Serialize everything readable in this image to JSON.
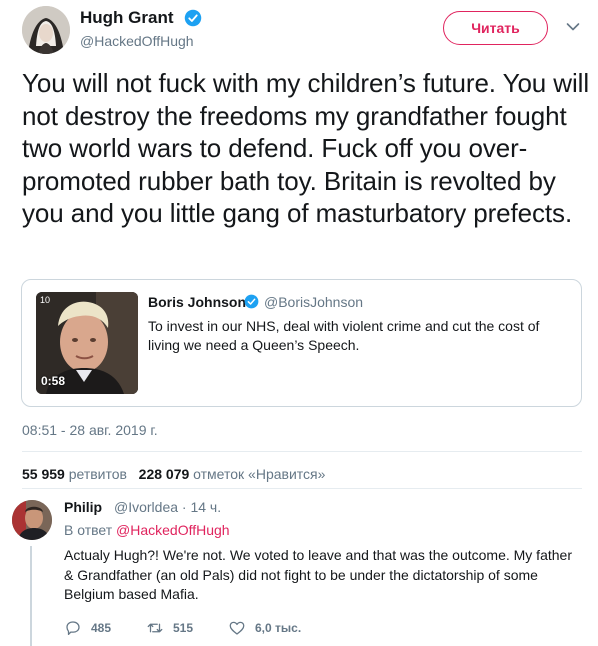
{
  "tweet": {
    "author_name": "Hugh Grant",
    "author_handle": "@HackedOffHugh",
    "follow_label": "Читать",
    "text": "You will not fuck with my children’s future. You will not destroy the freedoms my grandfather fought two world wars to defend. Fuck off you over-promoted rubber bath toy. Britain is revolted by you and you little gang of masturbatory prefects.",
    "timestamp": "08:51 - 28 авг. 2019 г.",
    "retweets_count": "55 959",
    "retweets_label": "ретвитов",
    "likes_count": "228 079",
    "likes_label": "отметок «Нравится»"
  },
  "quote": {
    "author_name": "Boris Johnson",
    "author_handle": "@BorisJohnson",
    "text": "To invest in our NHS, deal with violent crime and cut the cost of living we need a Queen’s Speech.",
    "media_duration": "0:58",
    "media_badge": "10"
  },
  "reply": {
    "author_name": "Philip",
    "author_handle": "@Ivorldea · 14 ч.",
    "reply_to_prefix": "В ответ",
    "reply_to_handle": "@HackedOffHugh",
    "text": "Actualy Hugh?! We're not. We voted to leave and that was the outcome. My father & Grandfather (an old Pals) did not fight to be under the dictatorship of some Belgium based Mafia.",
    "replies_count": "485",
    "retweets_count": "515",
    "likes_count": "6,0 тыс."
  },
  "icons": {
    "verified": "verified-badge-icon",
    "caret": "chevron-down-icon",
    "reply": "reply-icon",
    "retweet": "retweet-icon",
    "like": "heart-icon"
  },
  "colors": {
    "accent": "#e0245e",
    "verified": "#1da1f2",
    "muted": "#657786",
    "text": "#14171a"
  }
}
